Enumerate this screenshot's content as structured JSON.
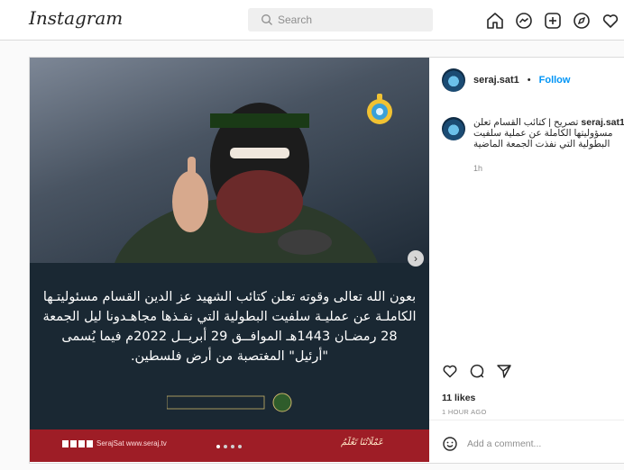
{
  "topbar": {
    "logo": "Instagram",
    "search_placeholder": "Search",
    "icons": [
      "home-icon",
      "messenger-icon",
      "new-post-icon",
      "explore-icon",
      "heart-icon"
    ]
  },
  "post": {
    "image": {
      "arabic_text": "بعون الله تعالى وقوته تعلن كتائب الشهيد عز الدين القسام مسئوليتـها الكاملـة عن عمليـة سلفيت البطولية التي نفـذها مجاهـدونا ليل الجمعة 28 رمضـان 1443هـ الموافــق 29 أبريــل 2022م فيما يُسمى \"أرئيل\" المغتصبة من أرض فلسطين.",
      "footer_left": "SerajSat  www.seraj.tv",
      "footer_right": "عَمْلَاتُنَا تَعْلَمُ",
      "carousel_index": 1,
      "carousel_total": 4,
      "next_label": "›"
    },
    "user": "seraj.sat1",
    "separator": "•",
    "follow_label": "Follow",
    "caption_text": "تصريح | كتائب القسام تعلن مسؤوليتها الكاملة عن عملية سلفيت البطولية التي نفذت الجمعة الماضية",
    "caption_time": "1h",
    "likes": "11 likes",
    "time_ago": "1 HOUR AGO",
    "comment_placeholder": "Add a comment..."
  },
  "colors": {
    "accent": "#0095f6",
    "panel": "#1a2833",
    "red_bar": "#9e1d26"
  }
}
